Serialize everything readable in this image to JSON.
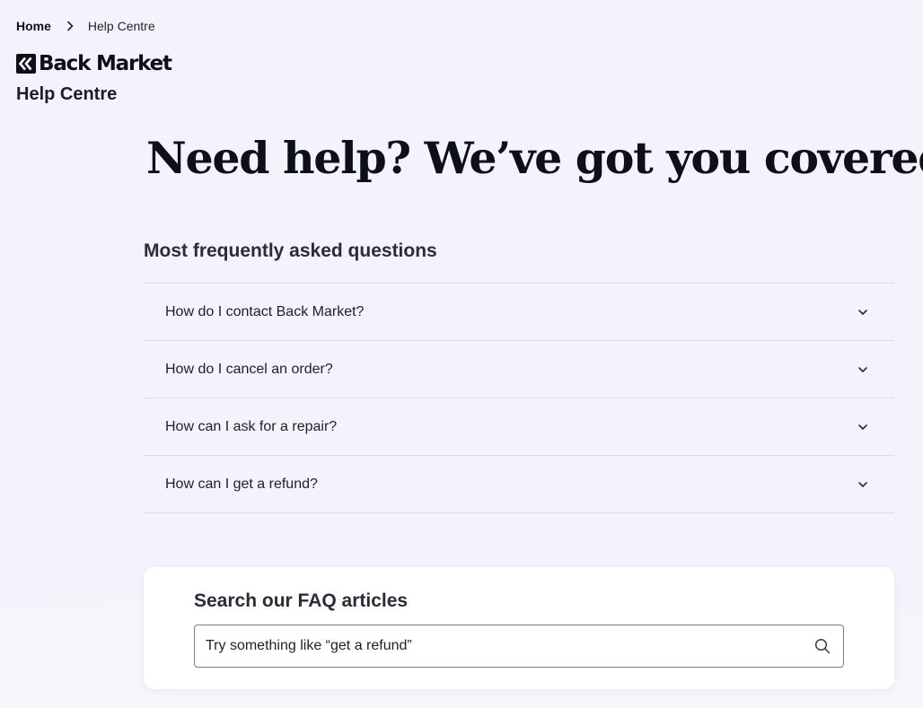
{
  "breadcrumb": {
    "home": "Home",
    "current": "Help Centre"
  },
  "brand": {
    "logo_text": "Back Market",
    "subtitle": "Help Centre",
    "logo_icon": "back-market-logo-icon"
  },
  "hero": {
    "title": "Need help? We’ve got you covered."
  },
  "faq": {
    "title": "Most frequently asked questions",
    "expand_icon": "chevron-down-icon",
    "items": [
      {
        "question": "How do I contact Back Market?"
      },
      {
        "question": "How do I cancel an order?"
      },
      {
        "question": "How can I ask for a repair?"
      },
      {
        "question": "How can I get a refund?"
      }
    ]
  },
  "search": {
    "title": "Search our FAQ articles",
    "placeholder": "Try something like “get a refund”",
    "value": "",
    "icon": "search-icon"
  },
  "colors": {
    "page_background": "#f4f2fb",
    "card_background": "#ffffff",
    "text_primary": "#0e1019",
    "divider": "#dedbe6",
    "input_border": "#7b7d87"
  }
}
